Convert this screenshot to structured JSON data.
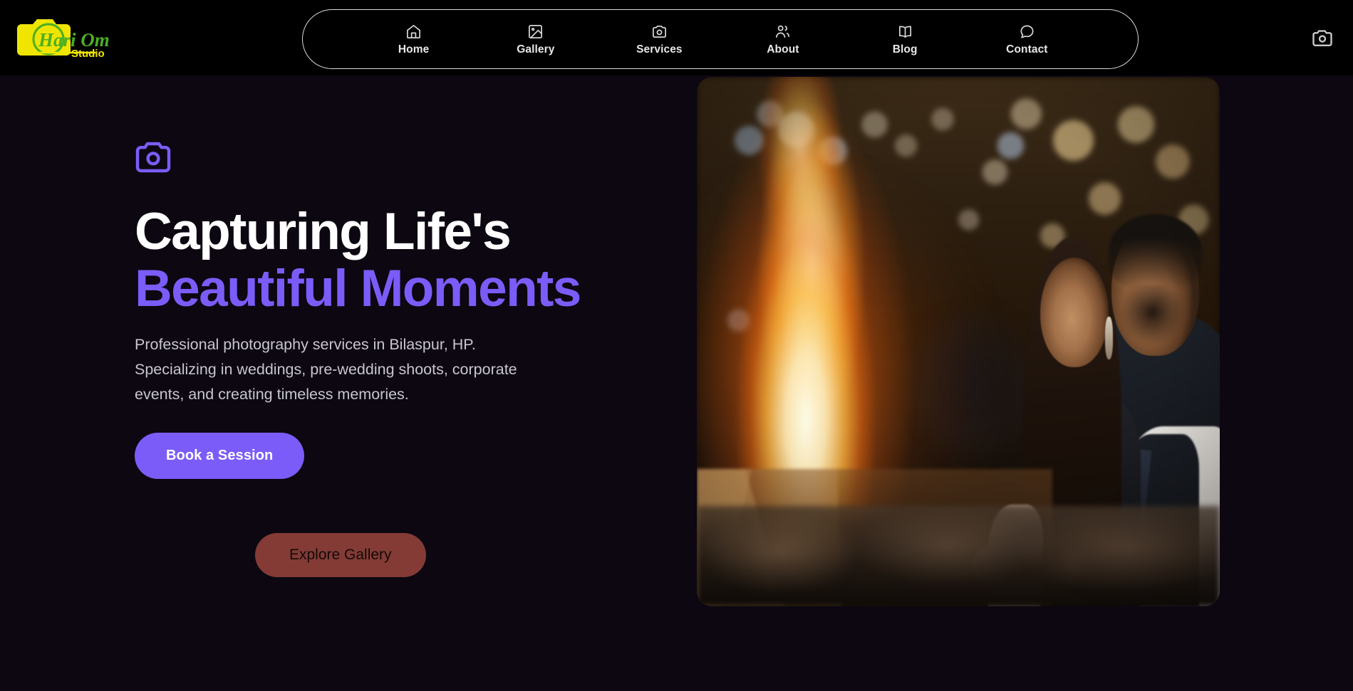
{
  "brand": {
    "name_line1": "Hari Om",
    "name_line2": "Studio",
    "logo_icon": "camera-logo-icon",
    "colors": {
      "script_green": "#4caf23",
      "yellow": "#f0e500"
    }
  },
  "header": {
    "nav": [
      {
        "label": "Home",
        "icon": "home-icon"
      },
      {
        "label": "Gallery",
        "icon": "image-icon"
      },
      {
        "label": "Services",
        "icon": "camera-icon"
      },
      {
        "label": "About",
        "icon": "users-icon"
      },
      {
        "label": "Blog",
        "icon": "book-open-icon"
      },
      {
        "label": "Contact",
        "icon": "message-circle-icon"
      }
    ],
    "action_icon": "camera-icon",
    "background": "#000000",
    "pill_border": "#d9d9d9"
  },
  "hero": {
    "badge_icon": "camera-icon",
    "title_line1": "Capturing Life's",
    "title_line2": "Beautiful Moments",
    "subtitle": "Professional photography services in Bilaspur, HP. Specializing in weddings, pre-wedding shoots, corporate events, and creating timeless memories.",
    "primary_button": "Book a Session",
    "gallery_button": "Explore Gallery",
    "image_alt": "Couple sitting beside a bonfire at night with bokeh string lights",
    "accent_color": "#7c5cf8",
    "background_color": "#0c0711"
  }
}
